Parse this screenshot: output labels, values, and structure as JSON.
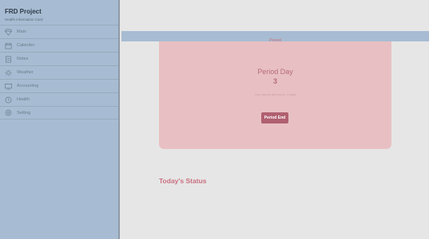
{
  "app": {
    "title": "FRD Project",
    "subtitle": "Health information Card"
  },
  "sidebar": {
    "items": [
      {
        "label": "Main",
        "icon": "gem-icon"
      },
      {
        "label": "Calender",
        "icon": "calendar-icon"
      },
      {
        "label": "Notes",
        "icon": "note-icon"
      },
      {
        "label": "Weather",
        "icon": "sun-icon"
      },
      {
        "label": "Accounting",
        "icon": "monitor-icon"
      },
      {
        "label": "Health",
        "icon": "clock-icon"
      },
      {
        "label": "Setting",
        "icon": "settings-icon"
      }
    ]
  },
  "header": {
    "title": "Period"
  },
  "period": {
    "label": "Period Day",
    "day": "3",
    "subtext": "Your period will end in 4 days",
    "end_button": "Period End"
  },
  "status": {
    "heading": "Today's Status"
  },
  "colors": {
    "sidebar": "#a7bcd2",
    "card": "#e8c0c3",
    "accent": "#c9707f",
    "button": "#b06070"
  }
}
